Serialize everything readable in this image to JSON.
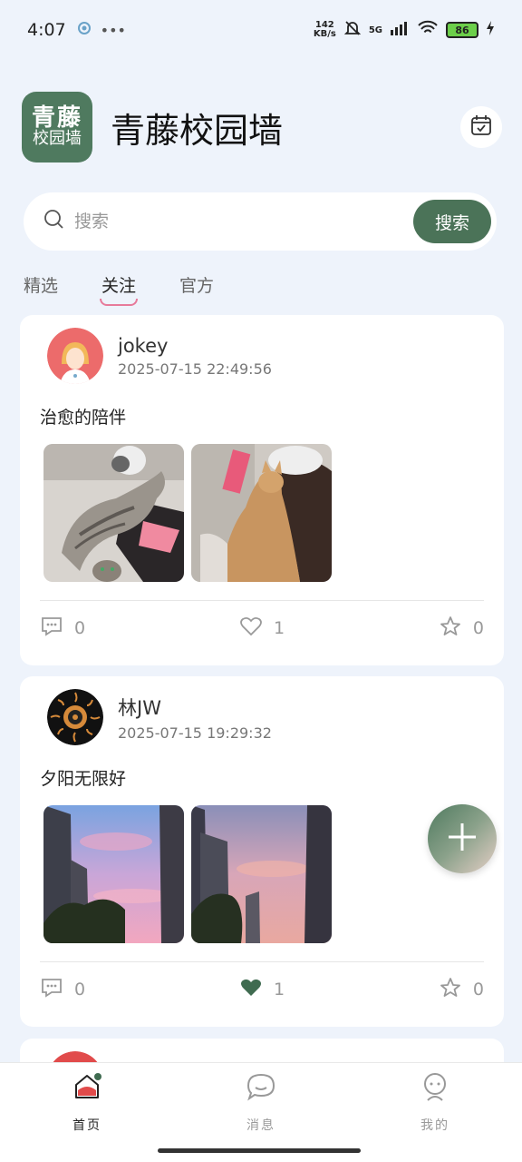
{
  "status_bar": {
    "time": "4:07",
    "speed_value": "142",
    "speed_unit": "KB/s",
    "network": "5G",
    "battery": "86"
  },
  "header": {
    "logo_line1": "青藤",
    "logo_line2": "校园墙",
    "title": "青藤校园墙"
  },
  "search": {
    "placeholder": "搜索",
    "button_label": "搜索"
  },
  "tabs": [
    {
      "label": "精选",
      "active": false
    },
    {
      "label": "关注",
      "active": true
    },
    {
      "label": "官方",
      "active": false
    }
  ],
  "posts": [
    {
      "username": "jokey",
      "timestamp": "2025-07-15 22:49:56",
      "text": "治愈的陪伴",
      "comments": "0",
      "likes": "1",
      "favorites": "0",
      "liked": false
    },
    {
      "username": "林JW",
      "timestamp": "2025-07-15 19:29:32",
      "text": "夕阳无限好",
      "comments": "0",
      "likes": "1",
      "favorites": "0",
      "liked": true
    }
  ],
  "bottom_nav": [
    {
      "label": "首页",
      "active": true
    },
    {
      "label": "消息",
      "active": false
    },
    {
      "label": "我的",
      "active": false
    }
  ],
  "colors": {
    "accent": "#4b7358",
    "liked": "#3f6b50",
    "background": "#eef3fb"
  }
}
